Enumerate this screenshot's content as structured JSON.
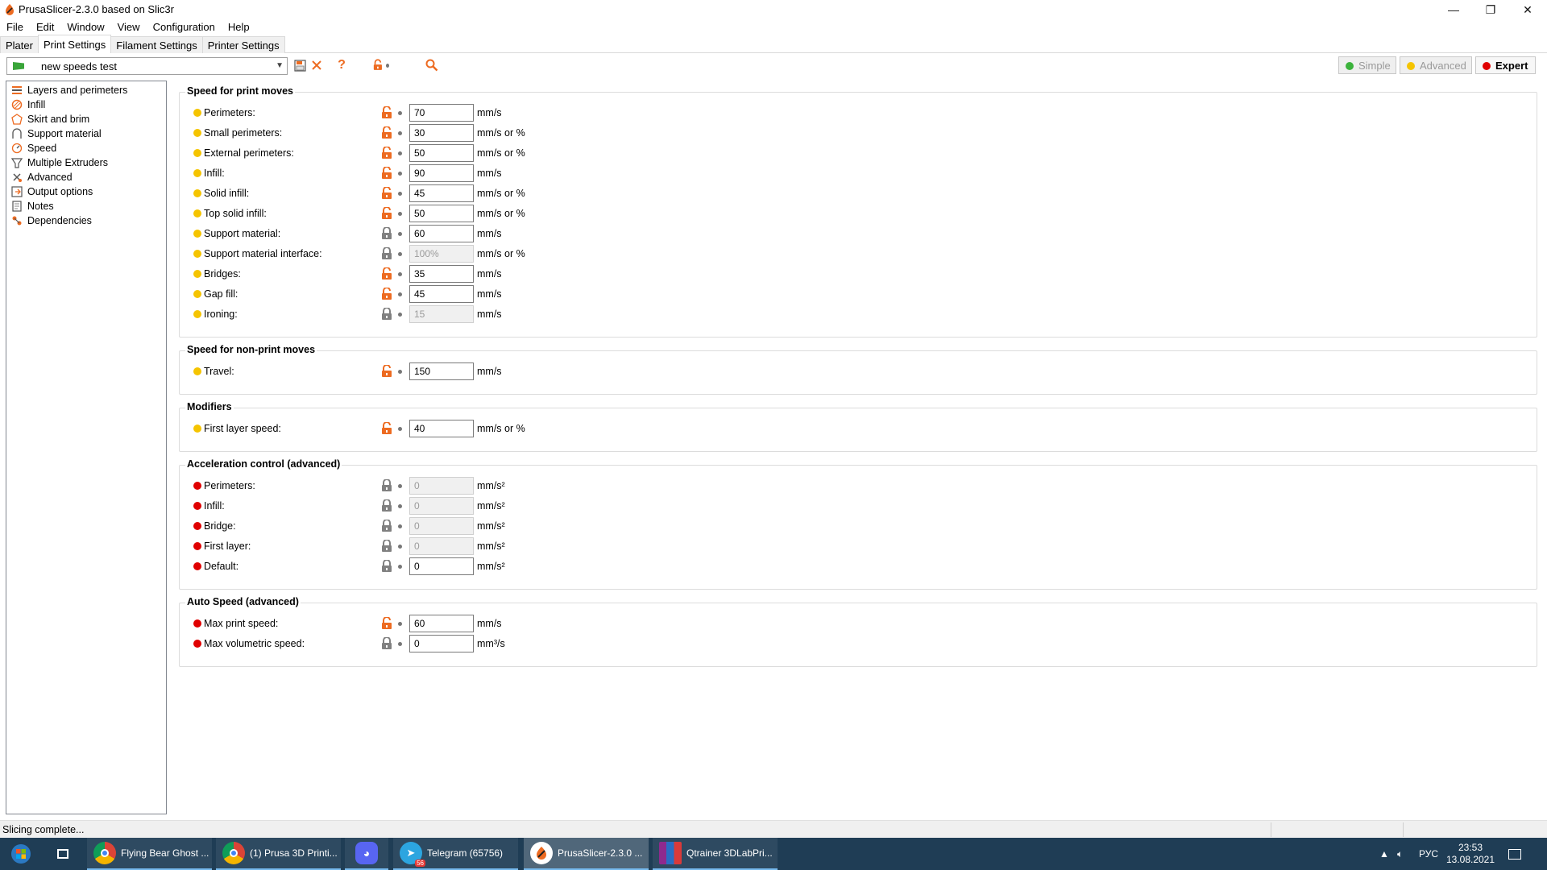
{
  "window": {
    "title": "PrusaSlicer-2.3.0 based on Slic3r",
    "minimize": "—",
    "restore": "❐",
    "close": "✕"
  },
  "menu": [
    "File",
    "Edit",
    "Window",
    "View",
    "Configuration",
    "Help"
  ],
  "tabs": [
    {
      "label": "Plater",
      "active": false
    },
    {
      "label": "Print Settings",
      "active": true
    },
    {
      "label": "Filament Settings",
      "active": false
    },
    {
      "label": "Printer Settings",
      "active": false
    }
  ],
  "preset": {
    "name": "new speeds test"
  },
  "modes": [
    {
      "label": "Simple",
      "color": "#3cb33c",
      "active": false
    },
    {
      "label": "Advanced",
      "color": "#f5c400",
      "active": false
    },
    {
      "label": "Expert",
      "color": "#e00000",
      "active": true
    }
  ],
  "tree": [
    {
      "label": "Layers and perimeters",
      "icon": "layers-icon"
    },
    {
      "label": "Infill",
      "icon": "infill-icon"
    },
    {
      "label": "Skirt and brim",
      "icon": "skirt-icon"
    },
    {
      "label": "Support material",
      "icon": "support-icon"
    },
    {
      "label": "Speed",
      "icon": "speed-icon"
    },
    {
      "label": "Multiple Extruders",
      "icon": "extruders-icon"
    },
    {
      "label": "Advanced",
      "icon": "advanced-icon"
    },
    {
      "label": "Output options",
      "icon": "output-icon"
    },
    {
      "label": "Notes",
      "icon": "notes-icon"
    },
    {
      "label": "Dependencies",
      "icon": "dependencies-icon"
    }
  ],
  "groups": [
    {
      "title": "Speed for print moves",
      "rows": [
        {
          "label": "Perimeters:",
          "value": "70",
          "unit": "mm/s",
          "level": "advanced",
          "lock": "open",
          "disabled": false
        },
        {
          "label": "Small perimeters:",
          "value": "30",
          "unit": "mm/s or %",
          "level": "advanced",
          "lock": "open",
          "disabled": false
        },
        {
          "label": "External perimeters:",
          "value": "50",
          "unit": "mm/s or %",
          "level": "advanced",
          "lock": "open",
          "disabled": false
        },
        {
          "label": "Infill:",
          "value": "90",
          "unit": "mm/s",
          "level": "advanced",
          "lock": "open",
          "disabled": false
        },
        {
          "label": "Solid infill:",
          "value": "45",
          "unit": "mm/s or %",
          "level": "advanced",
          "lock": "open",
          "disabled": false
        },
        {
          "label": "Top solid infill:",
          "value": "50",
          "unit": "mm/s or %",
          "level": "advanced",
          "lock": "open",
          "disabled": false
        },
        {
          "label": "Support material:",
          "value": "60",
          "unit": "mm/s",
          "level": "advanced",
          "lock": "closed",
          "disabled": false
        },
        {
          "label": "Support material interface:",
          "value": "100%",
          "unit": "mm/s or %",
          "level": "advanced",
          "lock": "closed",
          "disabled": true
        },
        {
          "label": "Bridges:",
          "value": "35",
          "unit": "mm/s",
          "level": "advanced",
          "lock": "open",
          "disabled": false
        },
        {
          "label": "Gap fill:",
          "value": "45",
          "unit": "mm/s",
          "level": "advanced",
          "lock": "open",
          "disabled": false
        },
        {
          "label": "Ironing:",
          "value": "15",
          "unit": "mm/s",
          "level": "advanced",
          "lock": "closed",
          "disabled": true
        }
      ]
    },
    {
      "title": "Speed for non-print moves",
      "rows": [
        {
          "label": "Travel:",
          "value": "150",
          "unit": "mm/s",
          "level": "advanced",
          "lock": "open",
          "disabled": false
        }
      ]
    },
    {
      "title": "Modifiers",
      "rows": [
        {
          "label": "First layer speed:",
          "value": "40",
          "unit": "mm/s or %",
          "level": "advanced",
          "lock": "open",
          "disabled": false
        }
      ]
    },
    {
      "title": "Acceleration control (advanced)",
      "rows": [
        {
          "label": "Perimeters:",
          "value": "0",
          "unit": "mm/s²",
          "level": "expert",
          "lock": "closed",
          "disabled": true
        },
        {
          "label": "Infill:",
          "value": "0",
          "unit": "mm/s²",
          "level": "expert",
          "lock": "closed",
          "disabled": true
        },
        {
          "label": "Bridge:",
          "value": "0",
          "unit": "mm/s²",
          "level": "expert",
          "lock": "closed",
          "disabled": true
        },
        {
          "label": "First layer:",
          "value": "0",
          "unit": "mm/s²",
          "level": "expert",
          "lock": "closed",
          "disabled": true
        },
        {
          "label": "Default:",
          "value": "0",
          "unit": "mm/s²",
          "level": "expert",
          "lock": "closed",
          "disabled": false
        }
      ]
    },
    {
      "title": "Auto Speed (advanced)",
      "rows": [
        {
          "label": "Max print speed:",
          "value": "60",
          "unit": "mm/s",
          "level": "expert",
          "lock": "open",
          "disabled": false
        },
        {
          "label": "Max volumetric speed:",
          "value": "0",
          "unit": "mm³/s",
          "level": "expert",
          "lock": "closed",
          "disabled": false
        }
      ]
    }
  ],
  "colors": {
    "advanced_bullet": "#f5c400",
    "expert_bullet": "#e00000",
    "lock_open": "#ed6b21",
    "lock_closed": "#808080"
  },
  "status": {
    "text": "Slicing complete..."
  },
  "taskbar": {
    "items": [
      {
        "label": "Flying Bear Ghost ...",
        "icon": "chrome-icon"
      },
      {
        "label": "(1) Prusa 3D Printi...",
        "icon": "chrome-icon"
      },
      {
        "label": "",
        "icon": "discord-icon"
      },
      {
        "label": "Telegram (65756)",
        "icon": "telegram-icon",
        "badge": "56"
      },
      {
        "label": "PrusaSlicer-2.3.0 ...",
        "icon": "prusaslicer-icon"
      },
      {
        "label": "Qtrainer 3DLabPri...",
        "icon": "winrar-icon"
      }
    ],
    "language": "РУС",
    "time": "23:53",
    "date": "13.08.2021"
  }
}
